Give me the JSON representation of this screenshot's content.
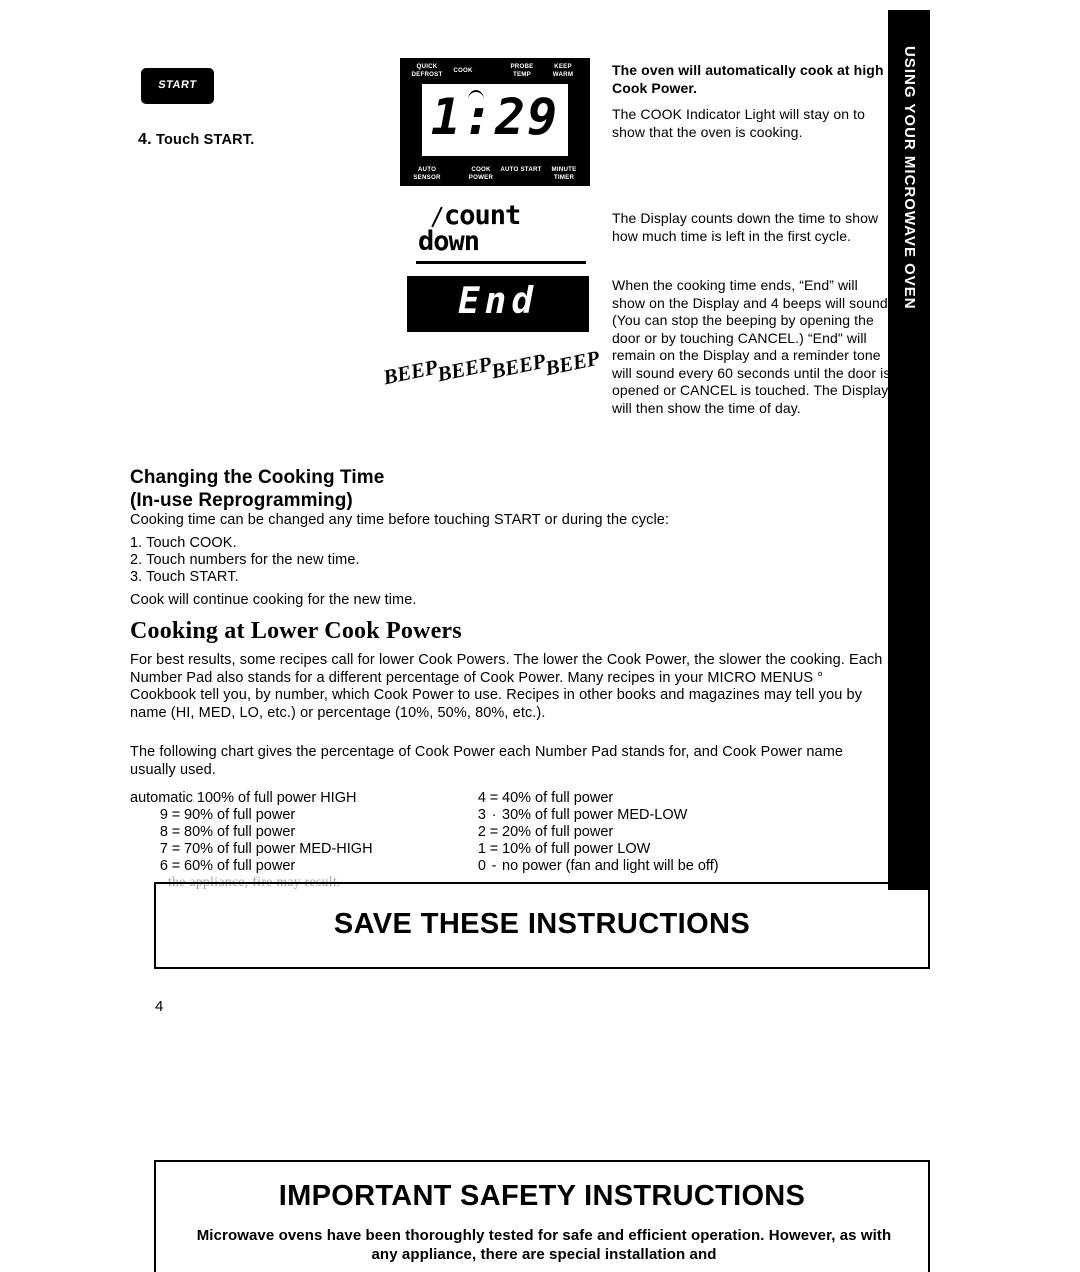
{
  "side_tab": {
    "label": "USING YOUR MICROWAVE OVEN"
  },
  "step": {
    "key_label": "START",
    "number": "4.",
    "text": "Touch START."
  },
  "control_panel": {
    "labels_top": [
      "QUICK DEFROST",
      "COOK",
      "PROBE TEMP",
      "KEEP WARM"
    ],
    "labels_bottom": [
      "AUTO SENSOR",
      "COOK POWER",
      "AUTO START",
      "MINUTE TIMER"
    ],
    "display_value": "1:29"
  },
  "countdown_graphic": {
    "line1": "count",
    "line2": "down"
  },
  "end_display": {
    "value": "End"
  },
  "beeps": [
    "BEEP",
    "BEEP",
    "BEEP",
    "BEEP"
  ],
  "right_column": {
    "p1": "The oven will automatically cook at high Cook Power.",
    "p2": "The COOK Indicator Light will stay on to show that the oven is cooking.",
    "p3": "The Display counts down the time to show how much time is left in the first cycle.",
    "p4": "When the cooking time ends, “End” will show on the Display and 4 beeps will sound. (You can stop the beeping by opening the door or by touching CANCEL.) “End\" will remain on the Display and a reminder tone will sound every 60 seconds until the door is opened or CANCEL is touched. The Display will then show the time of day."
  },
  "section_change": {
    "heading_line1": "Changing the Cooking Time",
    "heading_line2": "(In-use Reprogramming)",
    "intro": "Cooking time can be changed any time before touching START or during the cycle:",
    "steps": [
      "1. Touch COOK.",
      "2. Touch numbers for the new time.",
      "3. Touch START."
    ],
    "closing": "Cook will continue cooking for the new time."
  },
  "section_lower": {
    "heading": "Cooking at Lower Cook Powers",
    "p1": "For best results, some recipes call for lower Cook Powers. The lower the Cook Power, the slower the cooking. Each Number Pad also stands for a different percentage of Cook Power. Many recipes in your MICRO MENUS ° Cookbook tell you, by number, which Cook Power to use. Recipes in other books and magazines may tell you by name (HI, MED, LO, etc.) or percentage (10%, 50%, 80%, etc.).",
    "p2": "The following chart gives the percentage of Cook Power each Number Pad stands for, and Cook Power name usually used."
  },
  "power_chart": {
    "automatic_row": "automatic 100% of full power HIGH",
    "left": [
      {
        "pad": "9",
        "eq": "=",
        "text": "90% of full power"
      },
      {
        "pad": "8",
        "eq": "=",
        "text": "80% of full power"
      },
      {
        "pad": "7",
        "eq": "=",
        "text": "70% of full power MED-HIGH"
      },
      {
        "pad": "6",
        "eq": "=",
        "text": "60% of full power"
      }
    ],
    "right": [
      {
        "pad": "4",
        "eq": "=",
        "text": "40% of full power"
      },
      {
        "pad": "3",
        "eq": "·",
        "text": "30% of full power MED-LOW"
      },
      {
        "pad": "2",
        "eq": "=",
        "text": "20% of full power"
      },
      {
        "pad": "1",
        "eq": "=",
        "text": "10% of full power LOW"
      },
      {
        "pad": "0",
        "eq": "-",
        "text": "no power (fan and light will be off)"
      }
    ],
    "obscured_line": "the appliance, fire may result."
  },
  "save_box": {
    "title": "SAVE THESE INSTRUCTIONS"
  },
  "page_number": "4",
  "safety_box": {
    "title": "IMPORTANT SAFETY INSTRUCTIONS",
    "subtitle": "Microwave ovens have been thoroughly tested for safe and efficient operation. However, as with any appliance, there are special installation and"
  }
}
